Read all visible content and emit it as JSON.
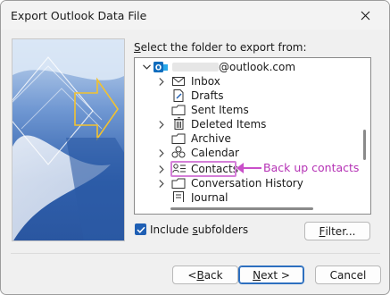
{
  "window": {
    "title": "Export Outlook Data File"
  },
  "prompt": {
    "pre": "",
    "hot": "S",
    "post": "elect the folder to export from:"
  },
  "tree": {
    "account_label": "@outlook.com",
    "items": [
      {
        "label": "Inbox",
        "icon": "inbox-icon",
        "expandable": true
      },
      {
        "label": "Drafts",
        "icon": "drafts-icon",
        "expandable": false
      },
      {
        "label": "Sent Items",
        "icon": "sent-items-icon",
        "expandable": false
      },
      {
        "label": "Deleted Items",
        "icon": "trash-icon",
        "expandable": true
      },
      {
        "label": "Archive",
        "icon": "archive-icon",
        "expandable": false
      },
      {
        "label": "Calendar",
        "icon": "calendar-icon",
        "expandable": true
      },
      {
        "label": "Contacts",
        "icon": "contacts-icon",
        "expandable": true
      },
      {
        "label": "Conversation History",
        "icon": "folder-icon",
        "expandable": true
      },
      {
        "label": "Journal",
        "icon": "journal-icon",
        "expandable": false
      }
    ]
  },
  "annotation": {
    "text": "Back up contacts",
    "color": "#b532b5"
  },
  "include_subfolders": {
    "pre": "Include ",
    "hot": "s",
    "post": "ubfolders",
    "checked": true
  },
  "buttons": {
    "filter": {
      "pre": "",
      "hot": "F",
      "post": "ilter..."
    },
    "back": {
      "pre": "< ",
      "hot": "B",
      "post": "ack"
    },
    "next": {
      "pre": "",
      "hot": "N",
      "post": "ext >"
    },
    "cancel": {
      "label": "Cancel"
    }
  },
  "colors": {
    "accent": "#1f5fb4",
    "highlight_box": "#d47fd8"
  }
}
